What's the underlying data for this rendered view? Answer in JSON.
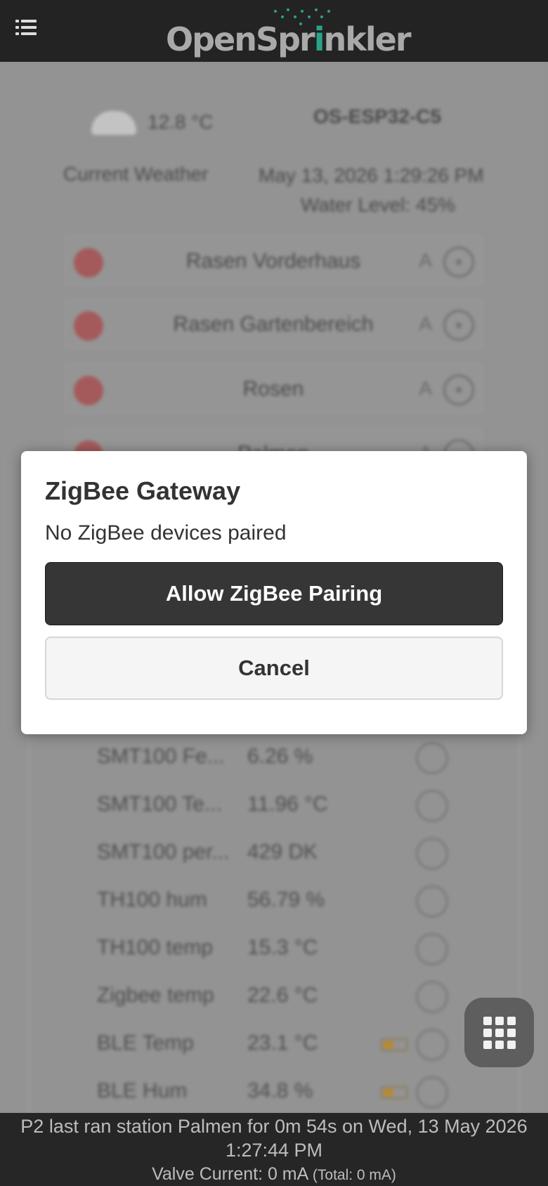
{
  "header": {
    "logo_prefix": "OpenSpr",
    "logo_i": "i",
    "logo_suffix": "nkler",
    "menu_icon": "list-menu-icon"
  },
  "status": {
    "temperature": "12.8 °C",
    "device_name": "OS-ESP32-C5",
    "weather_label": "Current Weather",
    "datetime": "May 13, 2026 1:29:26 PM",
    "water_level": "Water Level: 45%"
  },
  "stations": [
    {
      "name": "Rasen Vorderhaus",
      "mode": "A"
    },
    {
      "name": "Rasen Gartenbereich",
      "mode": "A"
    },
    {
      "name": "Rosen",
      "mode": "A"
    },
    {
      "name": "Palmen",
      "mode": "A"
    }
  ],
  "sensors": [
    {
      "name": "SMT100 Fe...",
      "value": "6.26 %"
    },
    {
      "name": "SMT100 Te...",
      "value": "11.96 °C"
    },
    {
      "name": "SMT100 per...",
      "value": "429 DK"
    },
    {
      "name": "TH100 hum",
      "value": "56.79 %"
    },
    {
      "name": "TH100 temp",
      "value": "15.3 °C"
    },
    {
      "name": "Zigbee temp",
      "value": "22.6 °C"
    },
    {
      "name": "BLE Temp",
      "value": "23.1 °C"
    },
    {
      "name": "BLE Hum",
      "value": "34.8 %"
    }
  ],
  "dialog": {
    "title": "ZigBee Gateway",
    "message": "No ZigBee devices paired",
    "primary_label": "Allow ZigBee Pairing",
    "secondary_label": "Cancel"
  },
  "footer": {
    "last_run": "P2 last ran station Palmen for 0m 54s on Wed, 13 May 2026 1:27:44 PM",
    "valve_current": "Valve Current: 0 mA",
    "valve_total": "(Total: 0 mA)"
  },
  "colors": {
    "header_bg": "#232323",
    "logo_accent": "#2aa38a",
    "primary_button": "#363636",
    "station_off": "#a45a5a"
  }
}
